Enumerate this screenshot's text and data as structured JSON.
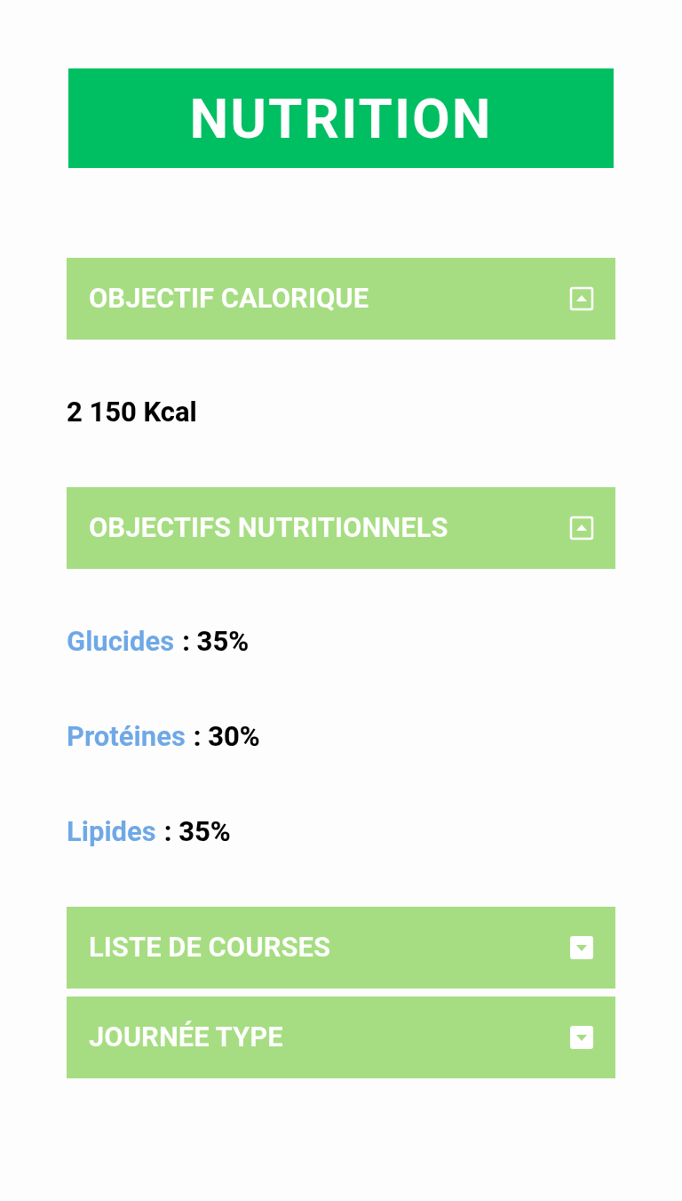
{
  "title": "NUTRITION",
  "sections": [
    {
      "title": "OBJECTIF CALORIQUE",
      "expanded": true,
      "items": [
        {
          "kind": "value",
          "text": "2 150 Kcal"
        }
      ]
    },
    {
      "title": "OBJECTIFS NUTRITIONNELS",
      "expanded": true,
      "items": [
        {
          "kind": "macro",
          "label": "Glucides",
          "value": ": 35%"
        },
        {
          "kind": "macro",
          "label": "Protéines",
          "value": ": 30%"
        },
        {
          "kind": "macro",
          "label": "Lipides",
          "value": ": 35%"
        }
      ]
    },
    {
      "title": "LISTE DE COURSES",
      "expanded": false
    },
    {
      "title": "JOURNÉE TYPE",
      "expanded": false
    }
  ]
}
